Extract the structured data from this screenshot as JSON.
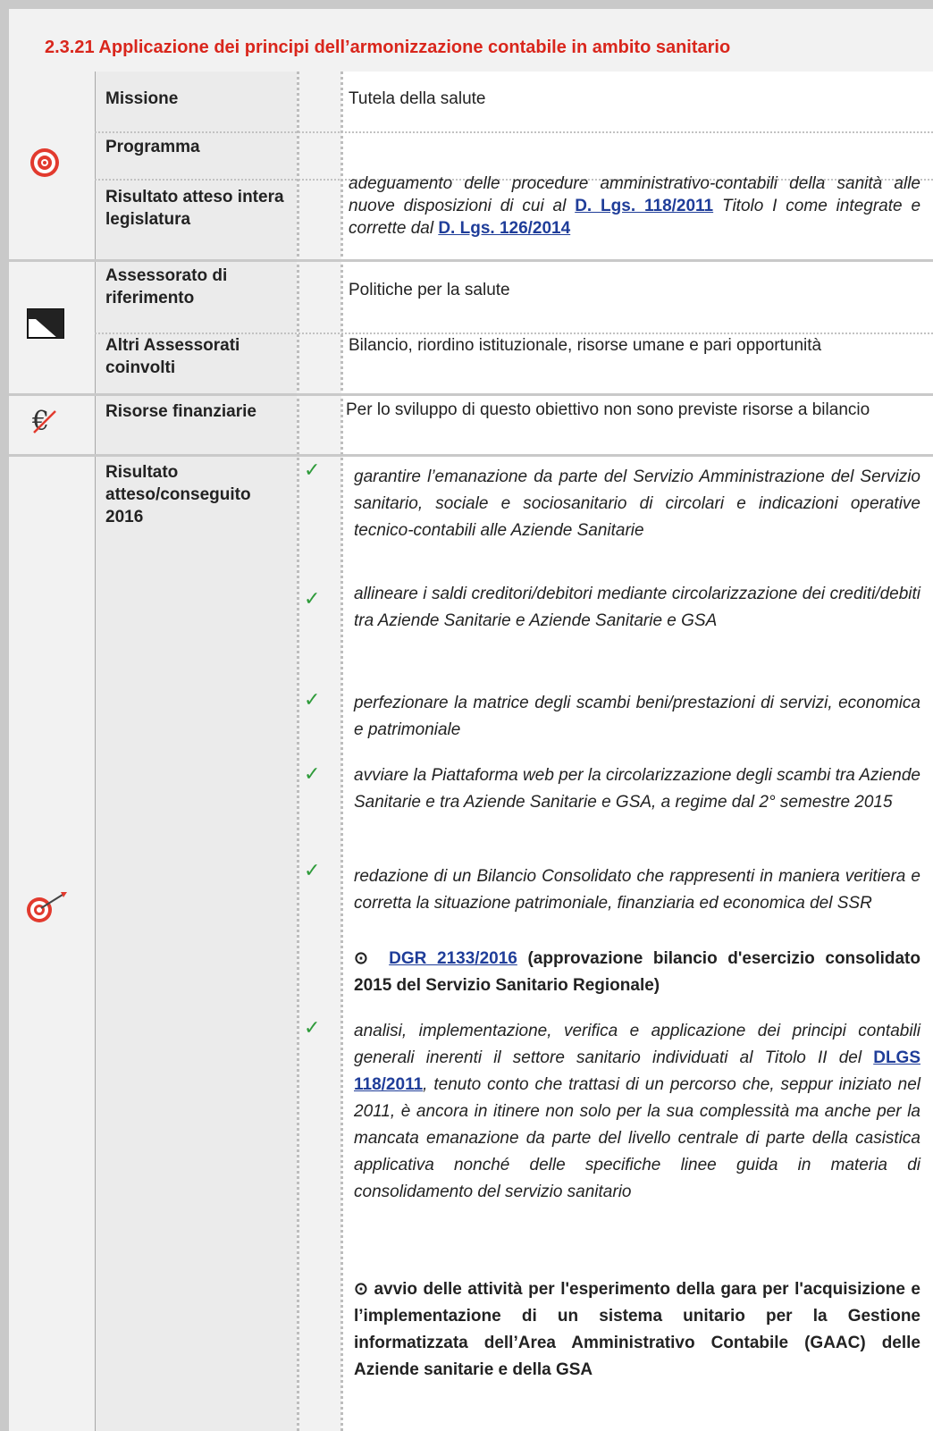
{
  "title": "2.3.21 Applicazione dei principi dell’armonizzazione contabile in ambito sanitario",
  "rows": {
    "missione": {
      "label": "Missione",
      "value": "Tutela della salute"
    },
    "programma": {
      "label": "Programma",
      "value": ""
    },
    "risultato_legislatura": {
      "label": "Risultato atteso intera legislatura",
      "text_a": "adeguamento delle procedure amministrativo-contabili della sanità alle nuove disposizioni di cui al ",
      "link_a": "D. Lgs. 118/2011",
      "text_b": " Titolo I come integrate e corrette dal ",
      "link_b": "D. Lgs. 126/2014"
    },
    "assessorato": {
      "label": "Assessorato di riferimento",
      "value": "Politiche per la salute"
    },
    "altri_assessorati": {
      "label": "Altri Assessorati coinvolti",
      "value": "Bilancio, riordino istituzionale, risorse umane e pari opportunità"
    },
    "risorse": {
      "label": "Risorse finanziarie",
      "value": "Per lo sviluppo di questo obiettivo non sono previste risorse a bilancio"
    },
    "risultato_2016": {
      "label": "Risultato atteso/conseguito 2016"
    }
  },
  "items": {
    "i1": "garantire l’emanazione da parte del Servizio Amministrazione del Servizio sanitario, sociale e sociosanitario di circolari e indicazioni operative tecnico-contabili alle Aziende Sanitarie",
    "i2": "allineare i saldi creditori/debitori mediante circolarizzazione dei crediti/debiti tra Aziende Sanitarie e Aziende Sanitarie e GSA",
    "i3": "perfezionare la matrice degli scambi beni/prestazioni di servizi, economica e patrimoniale",
    "i4": "avviare la Piattaforma web per la circolarizzazione degli scambi tra Aziende Sanitarie e tra Aziende Sanitarie e GSA, a regime dal 2° semestre 2015",
    "i5": " redazione di un Bilancio Consolidato che rappresenti in maniera veritiera e corretta la situazione patrimoniale, finanziaria ed economica del SSR",
    "i5_bullet": "⊙",
    "i5_link": "DGR 2133/2016",
    "i5_rest": " (approvazione bilancio d'esercizio consolidato 2015 del Servizio Sanitario Regionale)",
    "i6_a": "analisi, implementazione, verifica e applicazione dei principi contabili generali inerenti il settore sanitario individuati al Titolo II del ",
    "i6_link": "DLGS 118/2011",
    "i6_b": ", tenuto conto che trattasi di un percorso che, seppur iniziato nel 2011, è ancora in itinere non solo per la sua complessità ma anche per la mancata emanazione da parte del livello centrale di parte della casistica applicativa nonché delle specifiche linee guida in materia di consolidamento del servizio sanitario",
    "i6_bullet": "⊙",
    "i6_bold": " avvio delle attività per l'esperimento della gara per l'acquisizione e l’implementazione di un sistema unitario per la Gestione informatizzata dell’Area Amministrativo Contabile (GAAC) delle Aziende sanitarie e della GSA"
  },
  "icons": {
    "target": "target-icon",
    "flag": "flag-icon",
    "euro": "euro-icon",
    "dart": "target-dart-icon",
    "check": "check-icon",
    "check_glyph": "✓"
  },
  "colors": {
    "title": "#d9261c",
    "link": "#1f3d99",
    "check": "#2e9b3a"
  }
}
